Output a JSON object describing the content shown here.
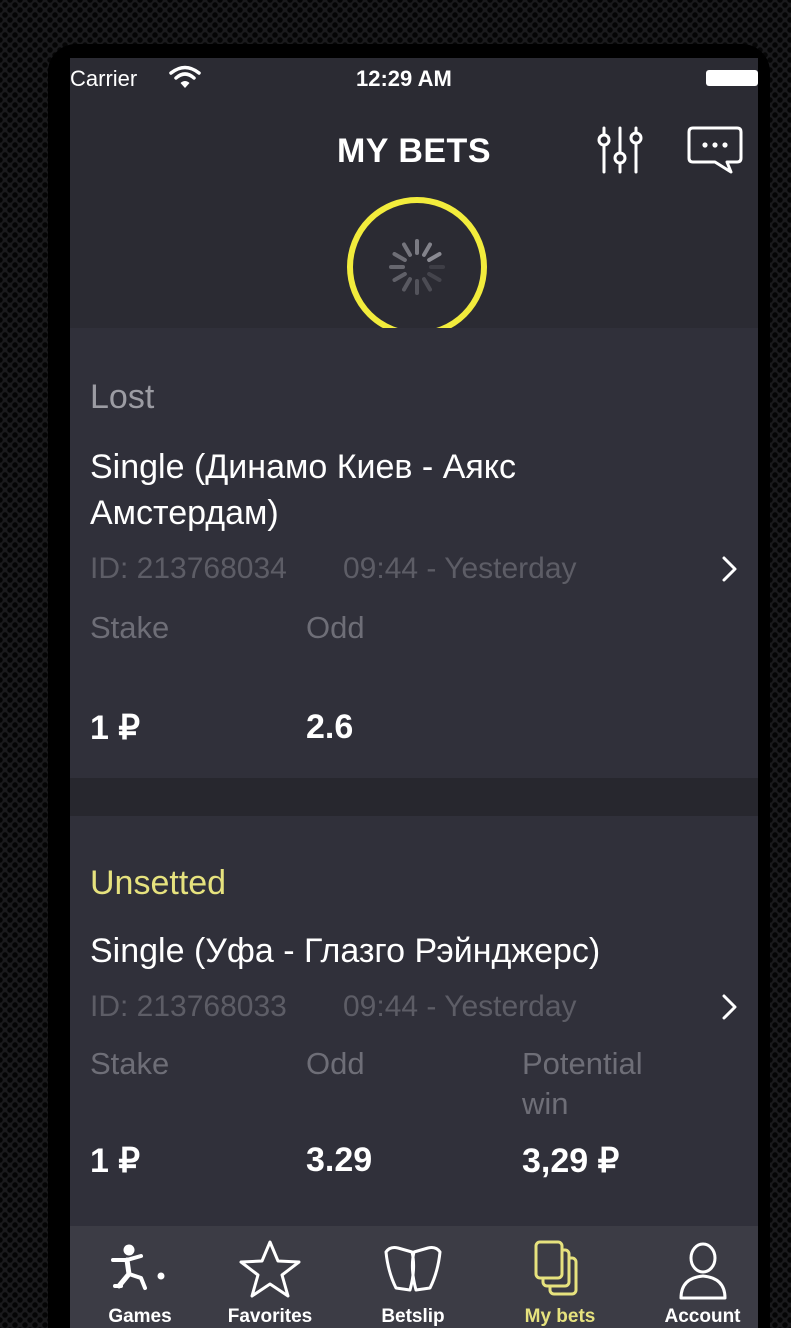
{
  "status_bar": {
    "carrier": "Carrier",
    "time": "12:29 AM"
  },
  "header": {
    "title": "MY BETS",
    "filter_icon": "sliders-icon",
    "chat_icon": "chat-bubble-icon",
    "loading": "spinner"
  },
  "bets": [
    {
      "status": "Lost",
      "title": "Single (Динамо Киев - Аякс Амстердам)",
      "id": "ID: 213768034",
      "time": "09:44 - Yesterday",
      "stake_label": "Stake",
      "odd_label": "Odd",
      "stake": "1 ₽",
      "odd": "2.6"
    },
    {
      "status": "Unsetted",
      "title": "Single (Уфа - Глазго Рэйнджерс)",
      "id": "ID: 213768033",
      "time": "09:44 - Yesterday",
      "stake_label": "Stake",
      "odd_label": "Odd",
      "potential_label": "Potential win",
      "stake": "1 ₽",
      "odd": "3.29",
      "potential": "3,29 ₽"
    }
  ],
  "tabs": [
    {
      "label": "Games",
      "icon": "soccer-player-icon",
      "active": false
    },
    {
      "label": "Favorites",
      "icon": "star-icon",
      "active": false
    },
    {
      "label": "Betslip",
      "icon": "betslip-icon",
      "active": false
    },
    {
      "label": "My bets",
      "icon": "stacked-cards-icon",
      "active": true
    },
    {
      "label": "Account",
      "icon": "person-icon",
      "active": false
    }
  ],
  "colors": {
    "accent": "#e6e27e",
    "highlight_ring": "#f2ec3c",
    "background": "#2b2b33",
    "card": "#30303a",
    "tabbar": "#3c3c45"
  }
}
